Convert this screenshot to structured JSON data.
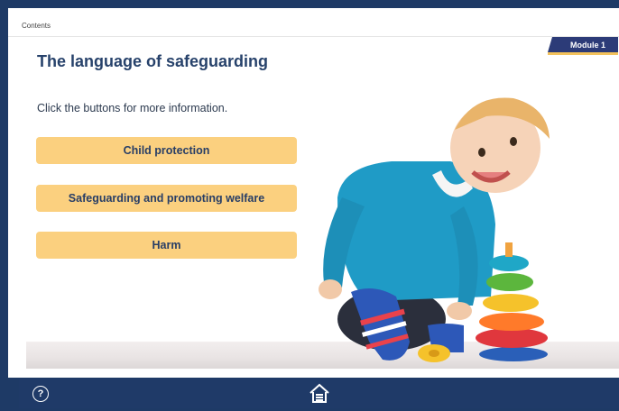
{
  "nav": {
    "contents_label": "Contents"
  },
  "module": {
    "label": "Module 1",
    "accent_color": "#2c3b78",
    "underline_color": "#f3c25c"
  },
  "page": {
    "title": "The language of safeguarding",
    "instructions": "Click the buttons for more information."
  },
  "buttons": [
    {
      "label": "Child protection"
    },
    {
      "label": "Safeguarding and promoting welfare"
    },
    {
      "label": "Harm"
    }
  ],
  "footer": {
    "help_label": "?",
    "help_icon": "question-circle-icon",
    "home_icon": "home-icon"
  },
  "colors": {
    "frame": "#1e3a66",
    "button": "#fbd07f",
    "title": "#27426b"
  }
}
